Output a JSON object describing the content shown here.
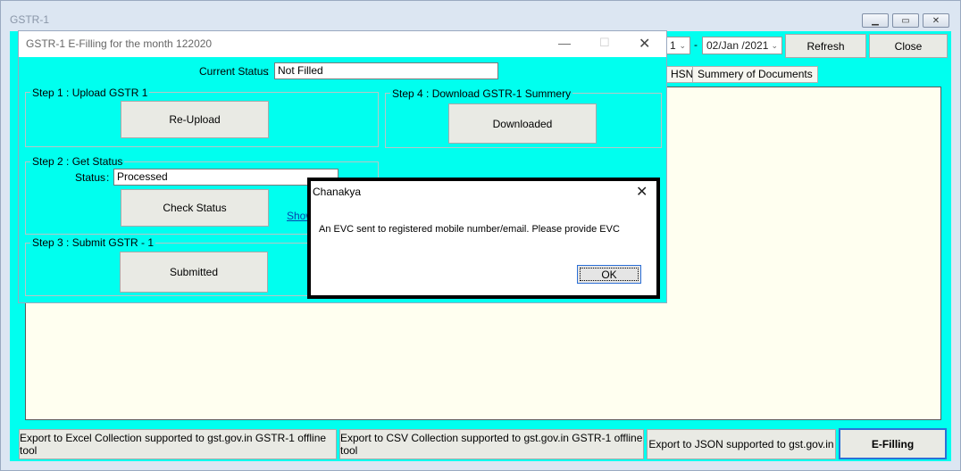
{
  "main_window": {
    "title": "GSTR-1",
    "date_from_fragment": "1",
    "date_separator": "-",
    "date_to": "02/Jan /2021",
    "refresh_label": "Refresh",
    "close_label": "Close",
    "tabs": [
      {
        "label": "HSN"
      },
      {
        "label": "Summery of Documents"
      }
    ],
    "bottom_buttons": [
      {
        "label": "Export to Excel Collection supported to gst.gov.in GSTR-1 offline tool"
      },
      {
        "label": "Export to CSV Collection supported to gst.gov.in GSTR-1 offline tool"
      },
      {
        "label": "Export to JSON supported to gst.gov.in"
      },
      {
        "label": "E-Filling"
      }
    ]
  },
  "efile_dialog": {
    "title": "GSTR-1 E-Filling for the month 122020",
    "current_status_label": "Current Status",
    "colon": ":",
    "current_status_value": "Not Filled",
    "step1": {
      "title": "Step 1 : Upload GSTR 1",
      "button": "Re-Upload"
    },
    "step2": {
      "title": "Step 2 : Get Status",
      "status_label": "Status",
      "status_value": "Processed",
      "button": "Check Status",
      "link": "Show"
    },
    "step3": {
      "title": "Step 3 : Submit GSTR - 1",
      "button": "Submitted"
    },
    "step4": {
      "title": "Step 4 : Download GSTR-1 Summery",
      "button": "Downloaded"
    }
  },
  "message_box": {
    "title": "Chanakya",
    "message": "An EVC sent to registered mobile number/email. Please provide EVC",
    "ok_label": "OK"
  }
}
